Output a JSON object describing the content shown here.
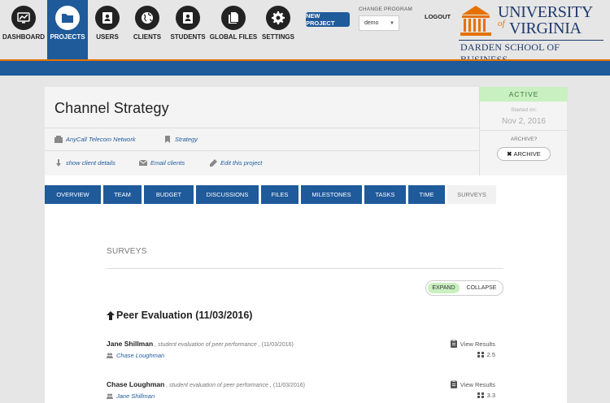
{
  "nav": {
    "items": [
      {
        "label": "DASHBOARD",
        "icon": "dashboard-icon"
      },
      {
        "label": "PROJECTS",
        "icon": "folder-icon",
        "active": true
      },
      {
        "label": "USERS",
        "icon": "user-card-icon"
      },
      {
        "label": "CLIENTS",
        "icon": "globe-icon"
      },
      {
        "label": "STUDENTS",
        "icon": "student-card-icon"
      },
      {
        "label": "GLOBAL FILES",
        "icon": "files-icon"
      },
      {
        "label": "SETTINGS",
        "icon": "gear-icon"
      }
    ],
    "new_project": "NEW PROJECT",
    "change_program_label": "CHANGE PROGRAM",
    "program_value": "demo",
    "logout": "LOGOUT"
  },
  "logo": {
    "line1": "UNIVERSITY",
    "of": "of",
    "line2": "VIRGINIA",
    "school": "DARDEN SCHOOL OF BUSINESS"
  },
  "project": {
    "title": "Channel Strategy",
    "client": "AnyCall Telecom Network",
    "category": "Strategy",
    "show_client_details": "show client details",
    "email_clients": "Email clients",
    "edit_project": "Edit this project",
    "status": "ACTIVE",
    "started_label": "Started on:",
    "started_date": "Nov 2, 2016",
    "archive_label": "ARCHIVE?",
    "archive_button": "ARCHIVE"
  },
  "tabs": [
    "OVERVIEW",
    "TEAM",
    "BUDGET",
    "DISCUSSIONS",
    "FILES",
    "MILESTONES",
    "TASKS",
    "TIME",
    "SURVEYS"
  ],
  "surveys": {
    "heading": "SURVEYS",
    "expand": "EXPAND",
    "collapse": "COLLAPSE",
    "evaluation_title": "Peer Evaluation (11/03/2016)",
    "rows": [
      {
        "name": "Jane Shillman",
        "desc": " , student evaluation of peer performance ,",
        "date": " (11/03/2016)",
        "evaluated": "Chase Loughman",
        "view": "View Results",
        "score": "2.5"
      },
      {
        "name": "Chase Loughman",
        "desc": " , student evaluation of peer performance ,",
        "date": " (11/03/2016)",
        "evaluated": "Jane Shillman",
        "view": "View Results",
        "score": "3.3"
      }
    ]
  },
  "colors": {
    "brand_blue": "#1f5a9a",
    "accent_orange": "#e57200",
    "active_green": "#c9f0c0"
  }
}
